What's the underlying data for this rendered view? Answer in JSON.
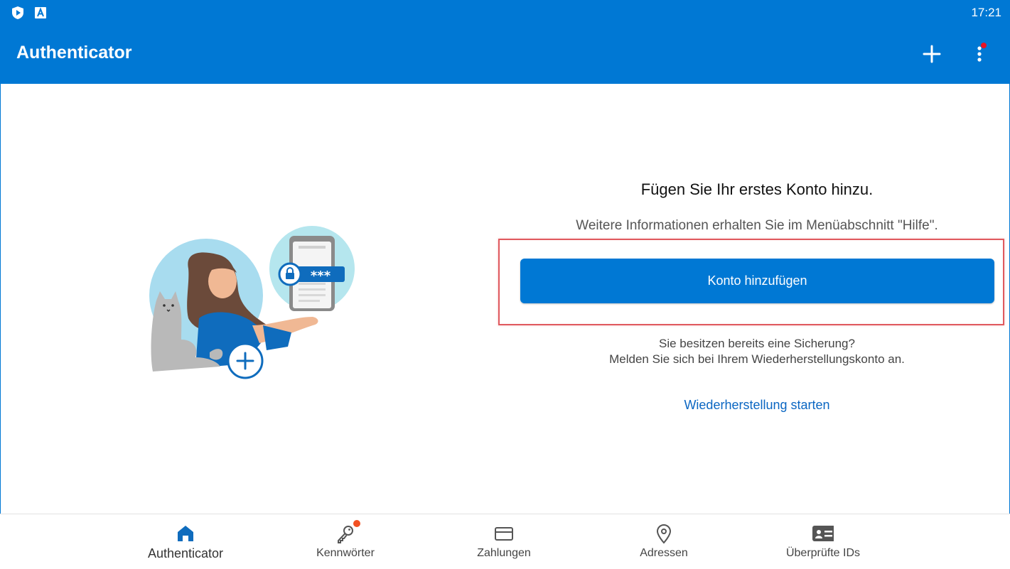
{
  "status_bar": {
    "time": "17:21",
    "icons": [
      "shield-play-icon",
      "android-a-icon"
    ]
  },
  "app_bar": {
    "title": "Authenticator",
    "actions": [
      "add-icon",
      "more-vertical-icon"
    ]
  },
  "main": {
    "headline": "Fügen Sie Ihr erstes Konto hinzu.",
    "subline": "Weitere Informationen erhalten Sie im Menüabschnitt \"Hilfe\".",
    "add_account_button": "Konto hinzufügen",
    "backup_line1": "Sie besitzen bereits eine Sicherung?",
    "backup_line2": "Melden Sie sich bei Ihrem Wiederherstellungskonto an.",
    "restore_link": "Wiederherstellung starten",
    "illustration": {
      "masked_code": "***"
    }
  },
  "bottom_nav": {
    "items": [
      {
        "label": "Authenticator",
        "icon": "home-icon",
        "active": true
      },
      {
        "label": "Kennwörter",
        "icon": "key-icon",
        "badge": true
      },
      {
        "label": "Zahlungen",
        "icon": "credit-card-icon"
      },
      {
        "label": "Adressen",
        "icon": "location-pin-icon"
      },
      {
        "label": "Überprüfte IDs",
        "icon": "id-card-icon"
      }
    ]
  },
  "colors": {
    "brand": "#0078d4",
    "badge": "#f25022",
    "highlight": "#e05a5f",
    "link": "#0a66c2"
  }
}
